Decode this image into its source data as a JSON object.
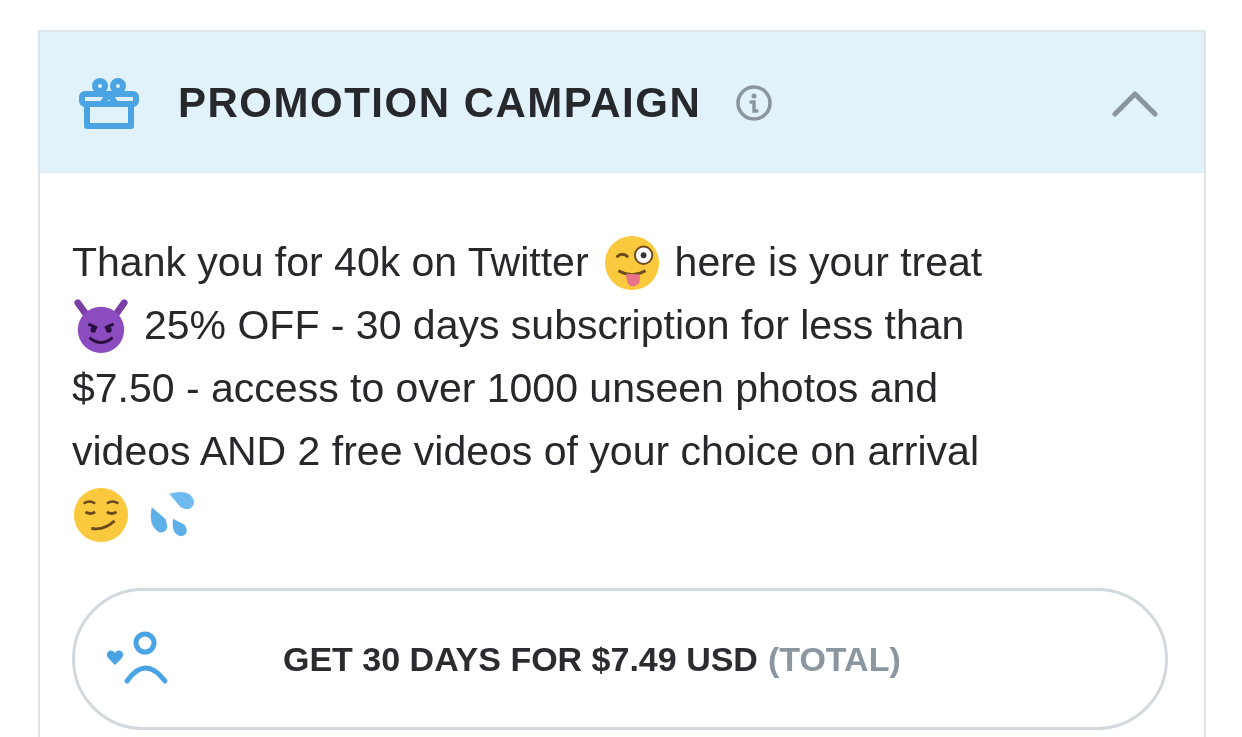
{
  "panel": {
    "title": "PROMOTION CAMPAIGN",
    "expanded": true
  },
  "message_lines": [
    [
      {
        "kind": "text",
        "text": "Thank you for 40k on Twitter"
      },
      {
        "kind": "wink"
      },
      {
        "kind": "text",
        "text": "here is your treat"
      }
    ],
    [
      {
        "kind": "devil"
      },
      {
        "kind": "text",
        "text": "25% OFF - 30 days subscription for less than"
      }
    ],
    [
      {
        "kind": "text",
        "text": "$7.50 - access to over 1000 unseen photos and"
      }
    ],
    [
      {
        "kind": "text",
        "text": "videos AND 2 free videos of your choice on arrival"
      }
    ],
    [
      {
        "kind": "smirk"
      },
      {
        "kind": "sweat"
      }
    ]
  ],
  "offer_button": {
    "label": "GET 30 DAYS FOR $7.49 USD",
    "note": "(TOTAL)"
  }
}
